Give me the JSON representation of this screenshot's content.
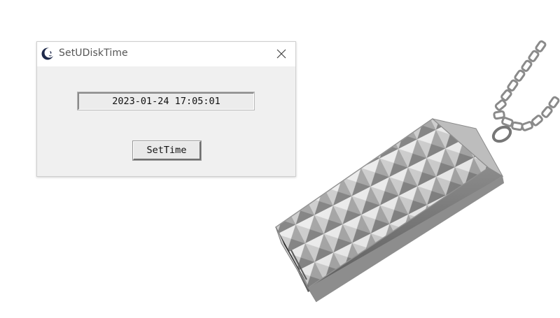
{
  "window": {
    "title": "SetUDiskTime",
    "app_icon": "moon-face-icon",
    "close_icon": "close-icon"
  },
  "time_field": {
    "value": "2023-01-24 17:05:01"
  },
  "buttons": {
    "set_time_label": "SetTime"
  },
  "product_image": {
    "subject": "usb-drive-pendant-icon"
  },
  "colors": {
    "window_background": "#f0f0f0",
    "titlebar_background": "#ffffff",
    "title_text": "#555555",
    "app_icon": "#1f2a4a"
  }
}
